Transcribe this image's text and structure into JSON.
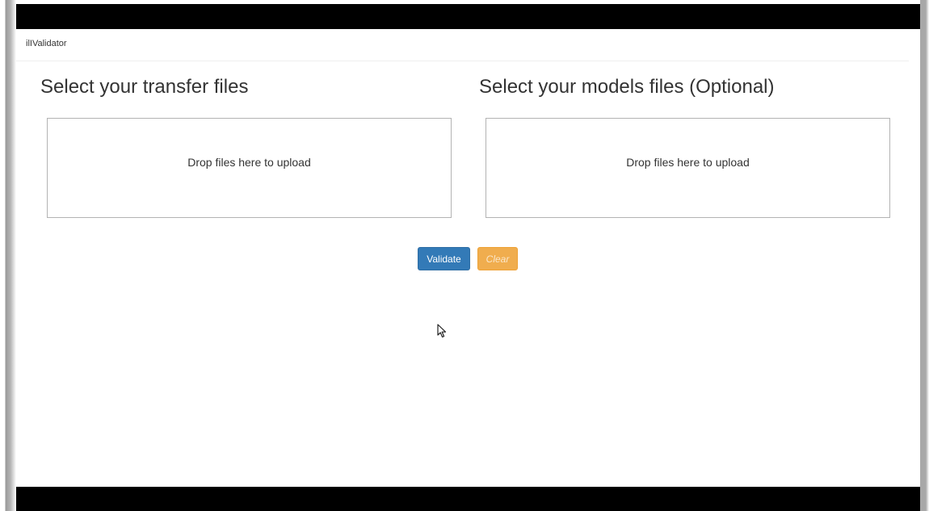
{
  "app": {
    "brand": "ilIValidator"
  },
  "transfer": {
    "title": "Select your transfer files",
    "drop_message": "Drop files here to upload"
  },
  "models": {
    "title": "Select your models files (Optional)",
    "drop_message": "Drop files here to upload"
  },
  "actions": {
    "validate_label": "Validate",
    "clear_label": "Clear"
  },
  "colors": {
    "primary": "#337ab7",
    "warning": "#f0ad4e"
  },
  "icons": {
    "cursor": "mouse-pointer-icon"
  }
}
